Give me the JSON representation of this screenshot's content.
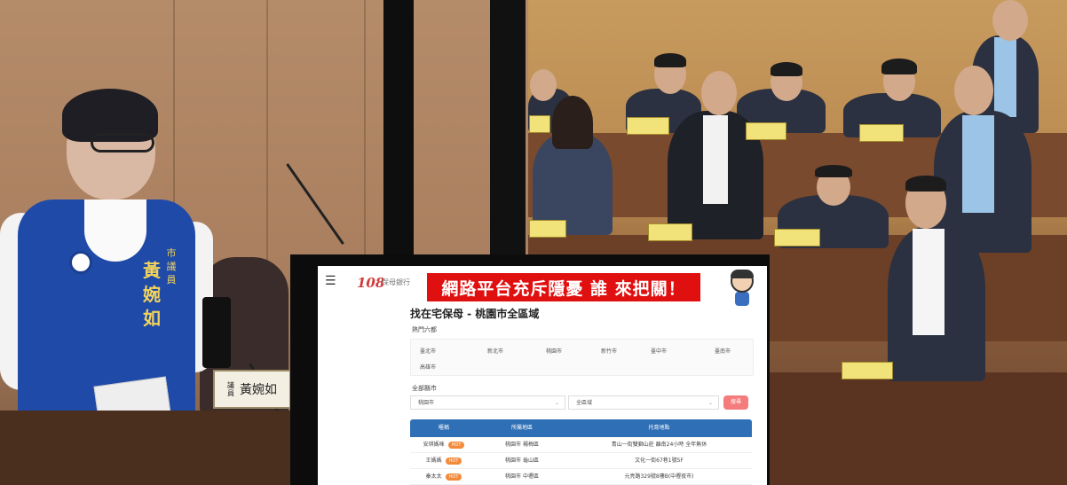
{
  "left_scene": {
    "vest_name": "黃婉如",
    "vest_title": "市議員",
    "nameplate_small": "議員",
    "nameplate_name": "黃婉如"
  },
  "overlay_app": {
    "logo": "108",
    "logo_sub": "保母銀行",
    "banner_text": "網路平台充斥隱憂 誰 來把關！",
    "page_title": "找在宅保母 - 桃園市全區域",
    "popular_label": "熱門六都",
    "cities": [
      "臺北市",
      "新北市",
      "桃園市",
      "新竹市",
      "臺中市",
      "臺南市",
      "高雄市"
    ],
    "all_label": "全部縣市",
    "city_select_value": "桃園市",
    "district_select_value": "全區域",
    "search_label": "搜尋",
    "table_headers": [
      "暱稱",
      "所屬地區",
      "托育地點"
    ],
    "rows": [
      {
        "name": "安琪媽咪",
        "tag": "HOT",
        "region": "桃園市 楊梅區",
        "place": "青山一街雙獅山莊 離南24小時 全年無休"
      },
      {
        "name": "王媽媽",
        "tag": "HOT",
        "region": "桃園市 龜山區",
        "place": "文化一街67巷1號5F"
      },
      {
        "name": "秦太太",
        "tag": "HOT",
        "region": "桃園市 中壢區",
        "place": "元亮路329號8樓B(中壢夜市)"
      }
    ]
  }
}
